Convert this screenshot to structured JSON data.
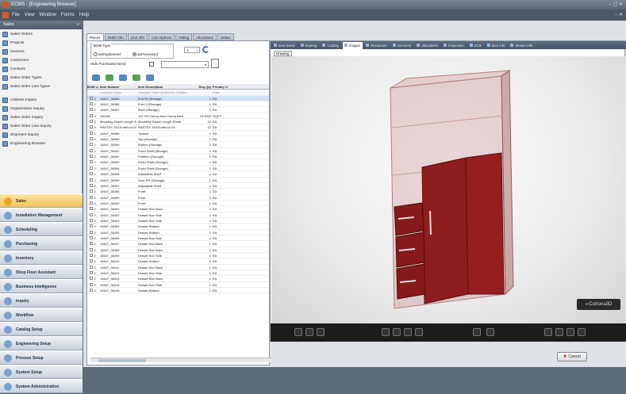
{
  "app": {
    "title": "ECMS - [Engineering Browser]"
  },
  "menu": [
    "File",
    "View",
    "Window",
    "Forms",
    "Help"
  ],
  "left_panel": {
    "header": "Sales",
    "links": [
      "Sales Orders",
      "Projects",
      "Invoices",
      "Customers",
      "Contacts",
      "Sales Order Types",
      "Sales Order Line Types",
      "Address Inquiry",
      "Organization Inquiry",
      "Sales Order Inquiry",
      "Sales Order Line Inquiry",
      "Shipment Inquiry",
      "Engineering Browser"
    ],
    "nav_buttons": [
      "Sales",
      "Installation Management",
      "Scheduling",
      "Purchasing",
      "Inventory",
      "Shop Floor Assistant",
      "Business Intelligence",
      "Inquiry",
      "Workflow",
      "Catalog Setup",
      "Engineering Setup",
      "Process Setup",
      "System Setup",
      "System Administration"
    ]
  },
  "top_tabs": [
    "Pieces",
    "Order Info",
    "Line Info",
    "Line Options",
    "Hiding",
    "Allocations",
    "Status"
  ],
  "bom": {
    "type_label": "BOM Type",
    "radio_engineered": "asEngineered",
    "radio_processed": "asProcessed",
    "qty": "1",
    "hide_purchased": "Hide Purchased Items:",
    "columns": [
      "BOM Level",
      "Item Number",
      "Item Description",
      "Req Qty",
      "Primary UC"
    ],
    "filter_row": [
      "",
      "Compare Open",
      "Compare Open (Unknown-Calibre)",
      "",
      "Click"
    ],
    "rows": [
      [
        "2",
        "14647_36385",
        "End Rt (Storage)",
        "1",
        "EA"
      ],
      [
        "2",
        "14647_36386",
        "End Lt (Storage)",
        "1",
        "EA"
      ],
      [
        "2",
        "14647_36387",
        "Back (Storage)",
        "1",
        "EA"
      ],
      [
        "3",
        "100252",
        "1/4\" P9 Cherry Med Cherry Med",
        "16.3920",
        "SQFT"
      ],
      [
        "3",
        "Mounting Dowel Length 30mm",
        "Mounting Dowel Length 30mm",
        "22",
        "EA"
      ],
      [
        "3",
        "RASTEX 15/18 without Wr",
        "RASTEX 15/18 without Wr",
        "22",
        "EA"
      ],
      [
        "2",
        "14647_36388",
        "Toekick",
        "1",
        "EA"
      ],
      [
        "2",
        "14647_36389",
        "Top (Storage)",
        "1",
        "EA"
      ],
      [
        "2",
        "14647_36390",
        "Bottom (Storage)",
        "1",
        "EA"
      ],
      [
        "2",
        "14647_36391",
        "Fixed Shelf (Storage)",
        "1",
        "EA"
      ],
      [
        "2",
        "14647_36392",
        "Partition (Storage)",
        "1",
        "EA"
      ],
      [
        "2",
        "14647_36393",
        "Fixed Shelf (Storage)",
        "1",
        "EA"
      ],
      [
        "2",
        "14647_36394",
        "Fixed Shelf (Storage)",
        "1",
        "EA"
      ],
      [
        "2",
        "14647_36395",
        "Adjustable Shelf",
        "1",
        "EA"
      ],
      [
        "2",
        "14647_36396",
        "Door RH (Storage)",
        "1",
        "EA"
      ],
      [
        "2",
        "14647_36397",
        "Adjustable Shelf",
        "1",
        "EA"
      ],
      [
        "2",
        "14647_36398",
        "Front",
        "1",
        "EA"
      ],
      [
        "2",
        "14647_36399",
        "Front",
        "1",
        "EA"
      ],
      [
        "2",
        "14647_36400",
        "Front",
        "1",
        "EA"
      ],
      [
        "2",
        "14647_36401",
        "Drawer Box Back",
        "1",
        "EA"
      ],
      [
        "2",
        "14647_36402",
        "Drawer Box Side",
        "1",
        "EA"
      ],
      [
        "2",
        "14647_36403",
        "Drawer Box Side",
        "1",
        "EA"
      ],
      [
        "2",
        "14647_36404",
        "Drawer Bottom",
        "1",
        "EA"
      ],
      [
        "2",
        "14647_36405",
        "Drawer Bottom",
        "1",
        "EA"
      ],
      [
        "2",
        "14647_36406",
        "Drawer Box Side",
        "1",
        "EA"
      ],
      [
        "2",
        "14647_36407",
        "Drawer Box Back",
        "1",
        "EA"
      ],
      [
        "2",
        "14647_36408",
        "Drawer Box Back",
        "1",
        "EA"
      ],
      [
        "2",
        "14647_36409",
        "Drawer Box Side",
        "1",
        "EA"
      ],
      [
        "2",
        "14647_36410",
        "Drawer Bottom",
        "1",
        "EA"
      ],
      [
        "2",
        "14647_36411",
        "Drawer Box Back",
        "1",
        "EA"
      ],
      [
        "2",
        "14647_36412",
        "Drawer Box Side",
        "1",
        "EA"
      ],
      [
        "2",
        "14647_36413",
        "Drawer Box Back",
        "1",
        "EA"
      ],
      [
        "2",
        "14647_36414",
        "Drawer Box Side",
        "1",
        "EA"
      ],
      [
        "2",
        "14647_36418",
        "Drawer Bottom",
        "1",
        "EA"
      ]
    ]
  },
  "viewer_tabs": [
    "Item Detail",
    "Routing",
    "Costing",
    "Images",
    "Resources",
    "Inventory",
    "Allocations",
    "Inspection",
    "DCS",
    "Item Info",
    "Vendor Info"
  ],
  "viewer": {
    "drawing_tab": "Drawing",
    "logo": "Cortona3D"
  },
  "colors": {
    "cabinet_glass": "#b97a7a",
    "door_wood": "#8e1d1d"
  },
  "cancel_label": "Cancel"
}
